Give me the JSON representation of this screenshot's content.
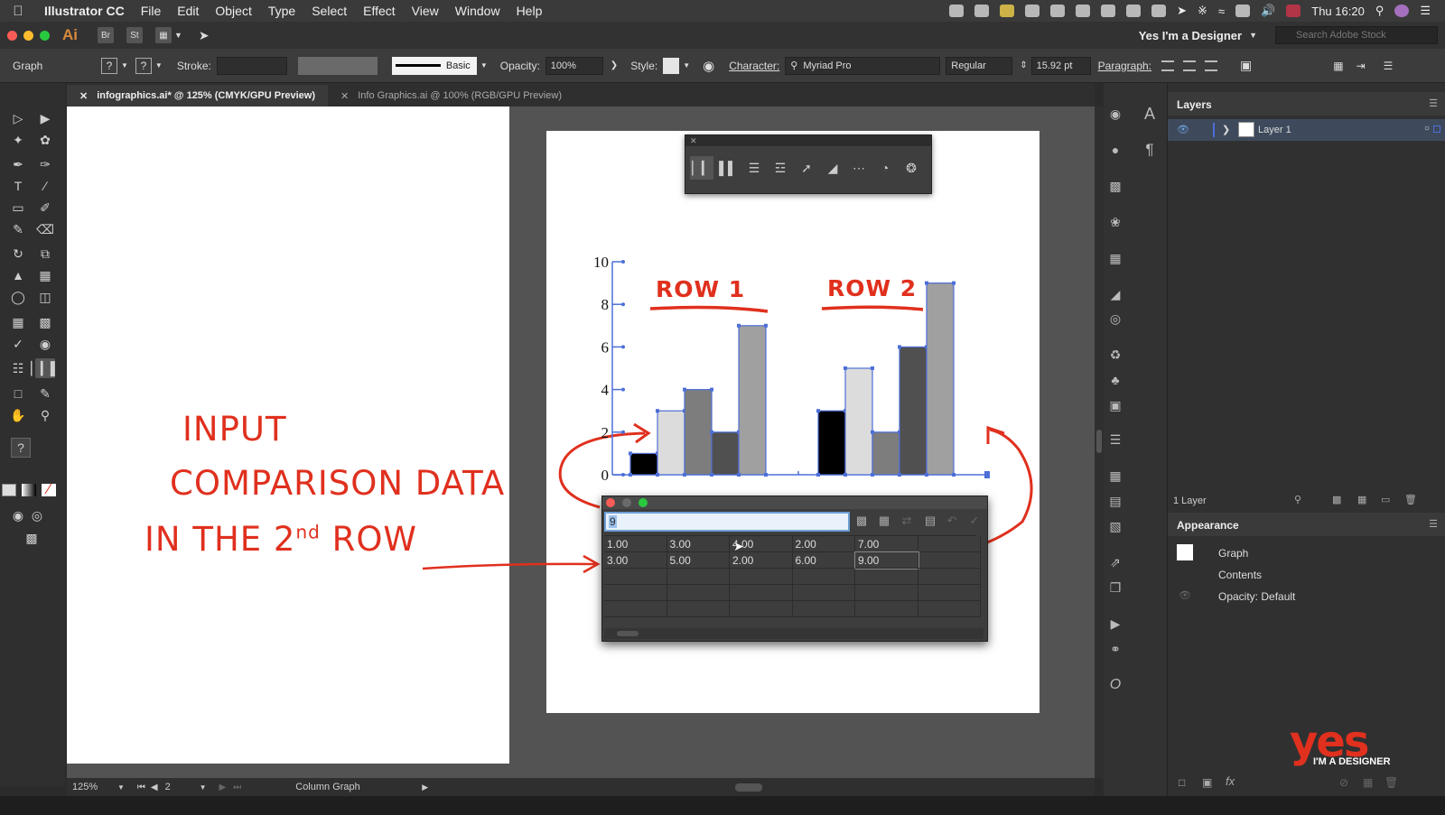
{
  "menubar": {
    "items": [
      "Illustrator CC",
      "File",
      "Edit",
      "Object",
      "Type",
      "Select",
      "Effect",
      "View",
      "Window",
      "Help"
    ],
    "clock": "Thu 16:20"
  },
  "appbar": {
    "logo": "Ai",
    "bridge": "Br",
    "stock_btn": "St",
    "workspace": "Yes I'm a Designer",
    "stock_search_placeholder": "Search Adobe Stock"
  },
  "control": {
    "object_type": "Graph",
    "stroke_label": "Stroke:",
    "brush": "Basic",
    "opacity_label": "Opacity:",
    "opacity_value": "100%",
    "style_label": "Style:",
    "character_label": "Character:",
    "font_family": "Myriad Pro",
    "font_style": "Regular",
    "font_size": "15.92 pt",
    "paragraph_label": "Paragraph:"
  },
  "tabs": [
    {
      "label": "infographics.ai* @ 125% (CMYK/GPU Preview)",
      "active": true
    },
    {
      "label": "Info Graphics.ai @ 100% (RGB/GPU Preview)",
      "active": false
    }
  ],
  "annotation": {
    "line1": "INPUT",
    "line2": "COMPARISON DATA",
    "line3_pre": "IN THE 2",
    "line3_sup": "nd",
    "line3_post": " ROW",
    "row1": "ROW 1",
    "row2": "ROW 2"
  },
  "chart_data": {
    "type": "bar",
    "categories": [
      "ROW 1",
      "ROW 2"
    ],
    "series": [
      {
        "values": [
          1,
          3
        ],
        "color": "#000000"
      },
      {
        "values": [
          3,
          5
        ],
        "color": "#dcdcdc"
      },
      {
        "values": [
          4,
          2
        ],
        "color": "#7d7d7d"
      },
      {
        "values": [
          2,
          6
        ],
        "color": "#505050"
      },
      {
        "values": [
          7,
          9
        ],
        "color": "#a0a0a0"
      }
    ],
    "ylim": [
      0,
      10
    ],
    "yticks": [
      "0",
      "2",
      "4",
      "6",
      "8",
      "10"
    ],
    "selection_color": "#4d6fd8"
  },
  "graph_data_window": {
    "cell_entry": "9",
    "rows": [
      [
        "1.00",
        "3.00",
        "4.00",
        "2.00",
        "7.00"
      ],
      [
        "3.00",
        "5.00",
        "2.00",
        "6.00",
        "9.00"
      ]
    ]
  },
  "status": {
    "zoom": "125%",
    "artboard": "2",
    "tool_name": "Column Graph"
  },
  "layers": {
    "title": "Layers",
    "layer_name": "Layer 1",
    "count": "1 Layer"
  },
  "appearance": {
    "title": "Appearance",
    "object": "Graph",
    "contents": "Contents",
    "opacity": "Opacity: Default"
  },
  "watermark": {
    "yes": "yes",
    "sub": "I'M A DESIGNER"
  },
  "colors": {
    "annotation_red": "#e0301e",
    "ui_dark": "#2b2b2b",
    "canvas_gray": "#535353"
  }
}
